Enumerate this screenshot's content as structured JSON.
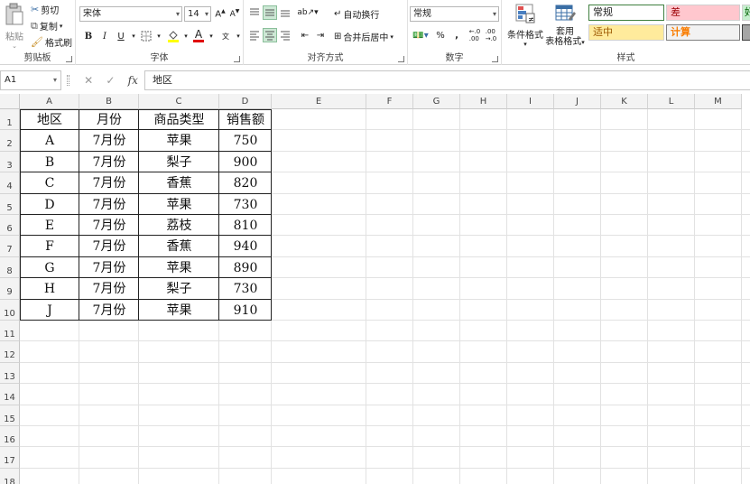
{
  "clipboard": {
    "paste_label": "粘贴",
    "cut_label": "剪切",
    "copy_label": "复制",
    "format_painter_label": "格式刷",
    "group_label": "剪贴板"
  },
  "font": {
    "family_value": "宋体",
    "size_value": "14",
    "group_label": "字体",
    "bold": "B",
    "italic": "I",
    "underline": "U",
    "font_color_glyph": "A",
    "phonetic_glyph": "文"
  },
  "alignment": {
    "wrap_text_label": "自动换行",
    "merge_center_label": "合并后居中",
    "group_label": "对齐方式"
  },
  "number": {
    "format_value": "常规",
    "percent": "%",
    "comma": ",",
    "group_label": "数字"
  },
  "styles": {
    "conditional_format_label": "条件格式",
    "table_format_line1": "套用",
    "table_format_line2": "表格格式",
    "normal_label": "常规",
    "bad_label": "差",
    "neutral_label": "适中",
    "calculation_label": "计算",
    "good_partial_label": "好",
    "group_label": "样式",
    "colors": {
      "normal_bg": "#ffffff",
      "bad_bg": "#ffc7ce",
      "bad_text": "#9c0006",
      "neutral_bg": "#ffeb9c",
      "neutral_text": "#9c5700",
      "calc_bg": "#f2f2f2",
      "calc_text": "#fa7d00"
    }
  },
  "formula_bar": {
    "name_box": "A1",
    "fx": "fx",
    "content": "地区"
  },
  "sheet": {
    "columns": [
      "A",
      "B",
      "C",
      "D",
      "E",
      "F",
      "G",
      "H",
      "I",
      "J",
      "K",
      "L",
      "M"
    ],
    "rows": [
      "1",
      "2",
      "3",
      "4",
      "5",
      "6",
      "7",
      "8",
      "9",
      "10",
      "11",
      "12",
      "13",
      "14",
      "15",
      "16",
      "17",
      "18"
    ],
    "header": [
      "地区",
      "月份",
      "商品类型",
      "销售额"
    ],
    "data": [
      [
        "A",
        "7月份",
        "苹果",
        "750"
      ],
      [
        "B",
        "7月份",
        "梨子",
        "900"
      ],
      [
        "C",
        "7月份",
        "香蕉",
        "820"
      ],
      [
        "D",
        "7月份",
        "苹果",
        "730"
      ],
      [
        "E",
        "7月份",
        "荔枝",
        "810"
      ],
      [
        "F",
        "7月份",
        "香蕉",
        "940"
      ],
      [
        "G",
        "7月份",
        "苹果",
        "890"
      ],
      [
        "H",
        "7月份",
        "梨子",
        "730"
      ],
      [
        "J",
        "7月份",
        "苹果",
        "910"
      ]
    ]
  }
}
